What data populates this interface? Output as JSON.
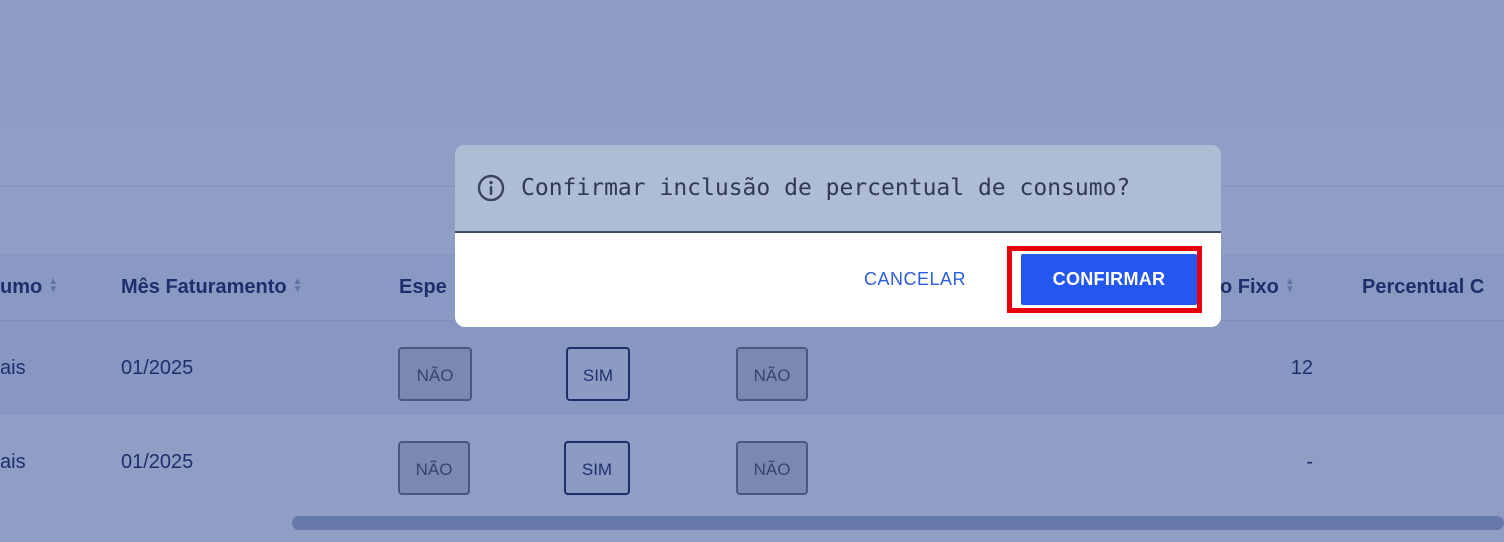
{
  "table": {
    "headers": [
      {
        "label": "umo"
      },
      {
        "label": "Mês Faturamento"
      },
      {
        "label": "Espe"
      },
      {
        "label": "o Fixo"
      },
      {
        "label": "Percentual C"
      }
    ],
    "rows": [
      {
        "col1": "ais",
        "mes": "01/2025",
        "p1": "NÃO",
        "p2": "SIM",
        "p3": "NÃO",
        "fixo": "12"
      },
      {
        "col1": "ais",
        "mes": "01/2025",
        "p1": "NÃO",
        "p2": "SIM",
        "p3": "NÃO",
        "fixo": "-"
      }
    ]
  },
  "dialog": {
    "title": "Confirmar inclusão de percentual de consumo?",
    "cancel_label": "CANCELAR",
    "confirm_label": "CONFIRMAR"
  },
  "colors": {
    "overlay": "#1c3787",
    "primary": "#2457f0",
    "highlight": "#e8000b"
  }
}
